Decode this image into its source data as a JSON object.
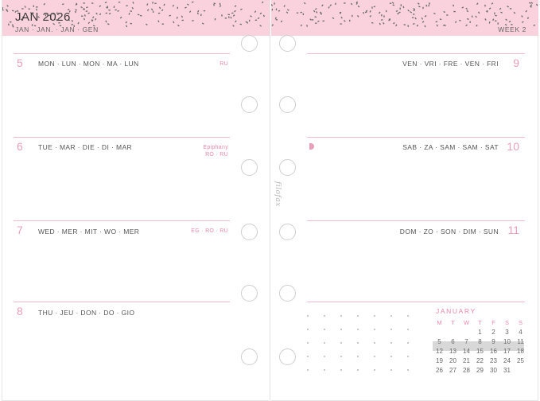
{
  "header": {
    "month_title": "JAN 2026",
    "month_translations": "JAN · JAN. · JAN · GEN",
    "week_label": "WEEK 2"
  },
  "days": [
    {
      "num": "5",
      "names": "MON · LUN · MON · MA · LUN",
      "note": "RU"
    },
    {
      "num": "6",
      "names": "TUE · MAR · DIE · DI · MAR",
      "note_line1": "Epiphany",
      "note_line2": "RO · RU"
    },
    {
      "num": "7",
      "names": "WED · MER · MIT · WO · MER",
      "note": "EG · RO · RU"
    },
    {
      "num": "8",
      "names": "THU · JEU · DON · DO · GIO"
    },
    {
      "num": "9",
      "names": "VEN · VRI · FRE · VEN · FRI"
    },
    {
      "num": "10",
      "names": "SAB · ZA · SAM · SAM · SAT"
    },
    {
      "num": "11",
      "names": "DOM · ZO · SON · DIM · SUN"
    }
  ],
  "brand": "filofax",
  "mini_calendar": {
    "title": "JANUARY",
    "weekday_heads": [
      "M",
      "T",
      "W",
      "T",
      "F",
      "S",
      "S"
    ],
    "weeks": [
      [
        "",
        "",
        "",
        "1",
        "2",
        "3",
        "4"
      ],
      [
        "5",
        "6",
        "7",
        "8",
        "9",
        "10",
        "11"
      ],
      [
        "12",
        "13",
        "14",
        "15",
        "16",
        "17",
        "18"
      ],
      [
        "19",
        "20",
        "21",
        "22",
        "23",
        "24",
        "25"
      ],
      [
        "26",
        "27",
        "28",
        "29",
        "30",
        "31",
        ""
      ]
    ],
    "highlighted_week": 2
  },
  "colors": {
    "banner_pink": "#f9d2de",
    "accent_pink": "#e9a0b6",
    "rule_pink": "#f2b9c9"
  }
}
